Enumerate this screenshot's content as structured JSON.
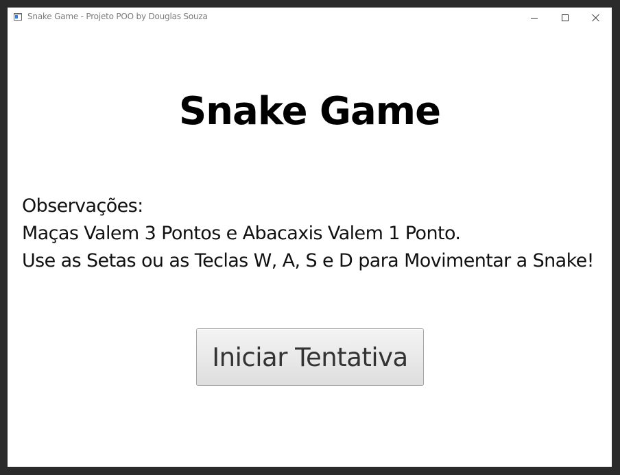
{
  "window": {
    "title": "Snake Game - Projeto POO by Douglas Souza"
  },
  "window_controls": {
    "minimize_icon": "minimize-icon",
    "maximize_icon": "maximize-icon",
    "close_icon": "close-icon"
  },
  "main": {
    "heading": "Snake Game",
    "notes_title": "Observações:",
    "note_1": "Maças Valem 3 Pontos e Abacaxis Valem 1 Ponto.",
    "note_2": "Use as Setas ou as Teclas W, A, S e D para Movimentar a Snake!",
    "start_button_label": "Iniciar Tentativa"
  },
  "colors": {
    "background": "#ffffff",
    "text": "#000000",
    "button_gradient_top": "#f4f4f4",
    "button_gradient_bottom": "#dedede"
  }
}
